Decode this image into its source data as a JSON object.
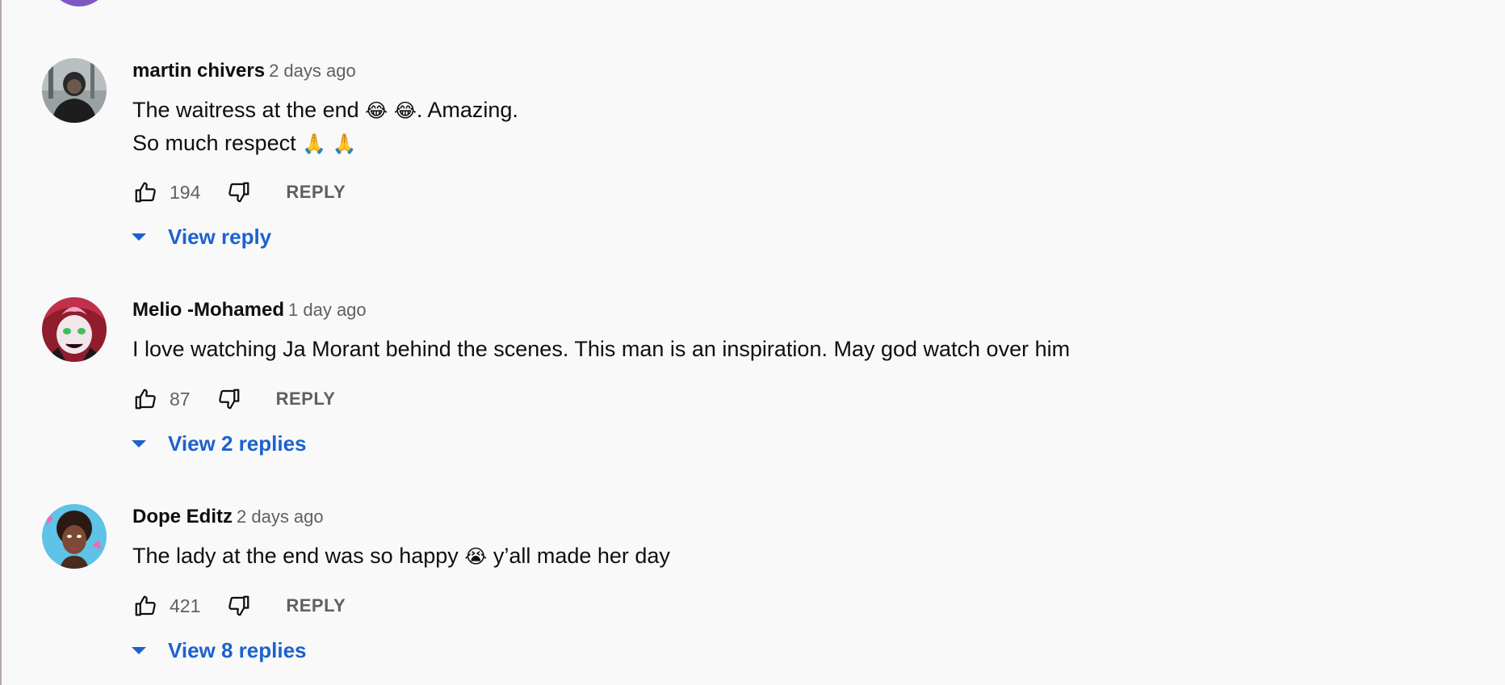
{
  "colors": {
    "background": "#f9f9f9",
    "link_blue": "#1c62cf",
    "meta_gray": "#606060",
    "text": "#0f0f0f"
  },
  "comments": [
    {
      "author": "martin chivers",
      "time": "2 days ago",
      "lines": [
        {
          "text": "The waitress at the end ",
          "emoji": "😂 😂",
          "after": ". Amazing."
        },
        {
          "text": "So much respect ",
          "emoji": "🙏 🙏",
          "after": ""
        }
      ],
      "likes": "194",
      "reply_label": "REPLY",
      "view_replies": "View reply",
      "avatar_icon": "man-in-dark-hoodie-avatar"
    },
    {
      "author": "Melio -Mohamed",
      "time": "1 day ago",
      "lines": [
        {
          "text": "I love watching Ja Morant behind the scenes. This man is an inspiration. May god watch over him",
          "emoji": "",
          "after": ""
        }
      ],
      "likes": "87",
      "reply_label": "REPLY",
      "view_replies": "View 2 replies",
      "avatar_icon": "anime-character-avatar"
    },
    {
      "author": "Dope Editz",
      "time": "2 days ago",
      "lines": [
        {
          "text": "The lady at the end was so happy ",
          "emoji": "😭",
          "after": " y’all made her day"
        }
      ],
      "likes": "421",
      "reply_label": "REPLY",
      "view_replies": "View 8 replies",
      "avatar_icon": "cartoon-woman-avatar"
    }
  ]
}
